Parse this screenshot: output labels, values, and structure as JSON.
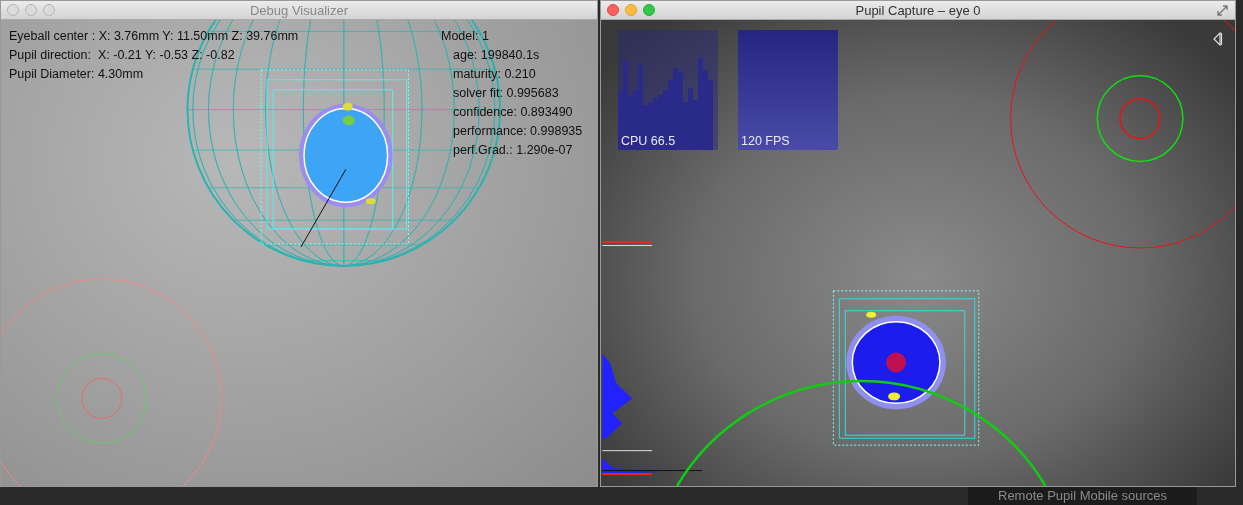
{
  "debug_window": {
    "title": "Debug Visualizer",
    "active": false,
    "eye_info": [
      "Eyeball center : X: 3.76mm Y: 11.50mm Z: 39.76mm",
      "Pupil direction:  X: -0.21 Y: -0.53 Z: -0.82",
      "Pupil Diameter: 4.30mm"
    ],
    "model": {
      "title": "Model: 1",
      "lines": [
        "age: 199840.1s",
        "maturity: 0.210",
        "solver fit: 0.995683",
        "confidence: 0.893490",
        "performance: 0.998935",
        "perf.Grad.: 1.290e-07"
      ]
    }
  },
  "capture_window": {
    "title": "Pupil Capture – eye 0",
    "active": true,
    "graphs": [
      {
        "kind": "cpu",
        "label": "CPU 66.5"
      },
      {
        "kind": "fps",
        "label": "120 FPS"
      }
    ]
  },
  "background_text": "Remote Pupil Mobile sources"
}
